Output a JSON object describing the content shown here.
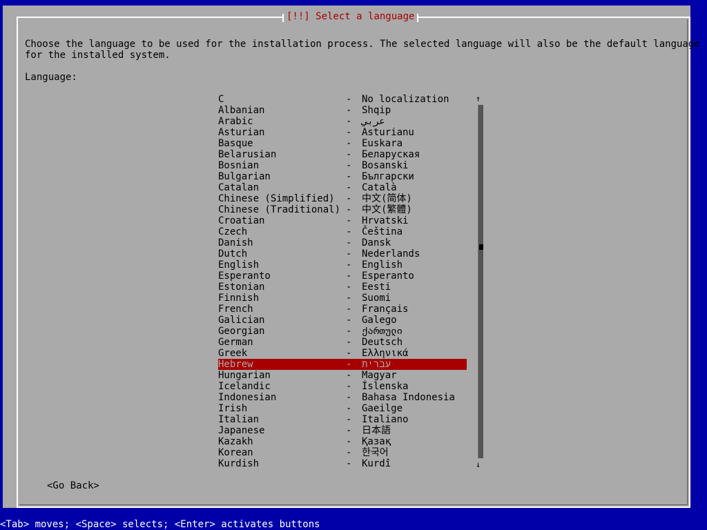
{
  "dialog": {
    "title": "[!!] Select a language",
    "prompt_line1": "Choose the language to be used for the installation process. The selected language will also be the default language",
    "prompt_line2": "for the installed system.",
    "language_label": "Language:"
  },
  "languages": [
    {
      "name": "C",
      "native": "No localization"
    },
    {
      "name": "Albanian",
      "native": "Shqip"
    },
    {
      "name": "Arabic",
      "native": "عربي"
    },
    {
      "name": "Asturian",
      "native": "Asturianu"
    },
    {
      "name": "Basque",
      "native": "Euskara"
    },
    {
      "name": "Belarusian",
      "native": "Беларуская"
    },
    {
      "name": "Bosnian",
      "native": "Bosanski"
    },
    {
      "name": "Bulgarian",
      "native": "Български"
    },
    {
      "name": "Catalan",
      "native": "Català"
    },
    {
      "name": "Chinese (Simplified)",
      "native": "中文(简体)"
    },
    {
      "name": "Chinese (Traditional)",
      "native": "中文(繁體)"
    },
    {
      "name": "Croatian",
      "native": "Hrvatski"
    },
    {
      "name": "Czech",
      "native": "Čeština"
    },
    {
      "name": "Danish",
      "native": "Dansk"
    },
    {
      "name": "Dutch",
      "native": "Nederlands"
    },
    {
      "name": "English",
      "native": "English"
    },
    {
      "name": "Esperanto",
      "native": "Esperanto"
    },
    {
      "name": "Estonian",
      "native": "Eesti"
    },
    {
      "name": "Finnish",
      "native": "Suomi"
    },
    {
      "name": "French",
      "native": "Français"
    },
    {
      "name": "Galician",
      "native": "Galego"
    },
    {
      "name": "Georgian",
      "native": "ქართული"
    },
    {
      "name": "German",
      "native": "Deutsch"
    },
    {
      "name": "Greek",
      "native": "Ελληνικά"
    },
    {
      "name": "Hebrew",
      "native": "עברית"
    },
    {
      "name": "Hungarian",
      "native": "Magyar"
    },
    {
      "name": "Icelandic",
      "native": "Íslenska"
    },
    {
      "name": "Indonesian",
      "native": "Bahasa Indonesia"
    },
    {
      "name": "Irish",
      "native": "Gaeilge"
    },
    {
      "name": "Italian",
      "native": "Italiano"
    },
    {
      "name": "Japanese",
      "native": "日本語"
    },
    {
      "name": "Kazakh",
      "native": "Қазақ"
    },
    {
      "name": "Korean",
      "native": "한국어"
    },
    {
      "name": "Kurdish",
      "native": "Kurdî"
    }
  ],
  "selected_index": 24,
  "separator": "-",
  "scrollbar": {
    "up_arrow": "↑",
    "down_arrow": "↓",
    "position_fraction": 0.4
  },
  "buttons": {
    "go_back": "<Go Back>"
  },
  "footer": "<Tab> moves; <Space> selects; <Enter> activates buttons",
  "colors": {
    "background": "#0000a8",
    "dialog": "#aaaaaa",
    "title": "#a80000",
    "selection": "#a80000",
    "footer_text": "#ffffff"
  }
}
